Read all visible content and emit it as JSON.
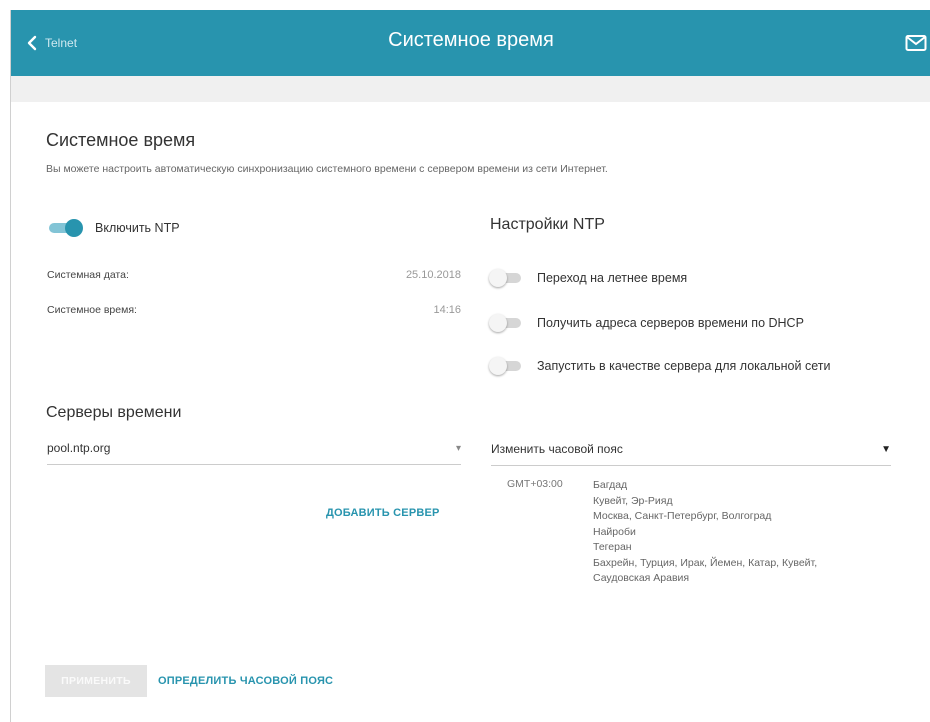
{
  "header": {
    "back_label": "Telnet",
    "title": "Системное время",
    "mail_icon": "mail-icon"
  },
  "main": {
    "title": "Системное время",
    "description": "Вы можете настроить автоматическую синхронизацию системного времени с сервером времени из сети Интернет.",
    "ntp_enabled": {
      "label": "Включить NTP",
      "on": true
    },
    "system_date": {
      "label": "Системная дата:",
      "value": "25.10.2018"
    },
    "system_time": {
      "label": "Системное время:",
      "value": "14:16"
    }
  },
  "ntp_settings": {
    "title": "Настройки NTP",
    "dst": {
      "label": "Переход на летнее время",
      "on": false
    },
    "dhcp": {
      "label": "Получить адреса серверов времени по DHCP",
      "on": false
    },
    "local_server": {
      "label": "Запустить в качестве сервера для локальной сети",
      "on": false
    }
  },
  "time_servers": {
    "title": "Серверы времени",
    "server_value": "pool.ntp.org",
    "add_server": "ДОБАВИТЬ СЕРВЕР"
  },
  "timezone": {
    "select_label": "Изменить часовой пояс",
    "offset": "GMT+03:00",
    "cities": [
      "Багдад",
      "Кувейт, Эр-Рияд",
      "Москва, Санкт-Петербург, Волгоград",
      "Найроби",
      "Тегеран",
      "Бахрейн, Турция, Ирак, Йемен, Катар, Кувейт,",
      "Саудовская Аравия"
    ]
  },
  "footer": {
    "apply": "ПРИМЕНИТЬ",
    "detect_tz": "ОПРЕДЕЛИТЬ ЧАСОВОЙ ПОЯС"
  },
  "colors": {
    "accent": "#2894ae",
    "header_bg": "#2894ae"
  }
}
